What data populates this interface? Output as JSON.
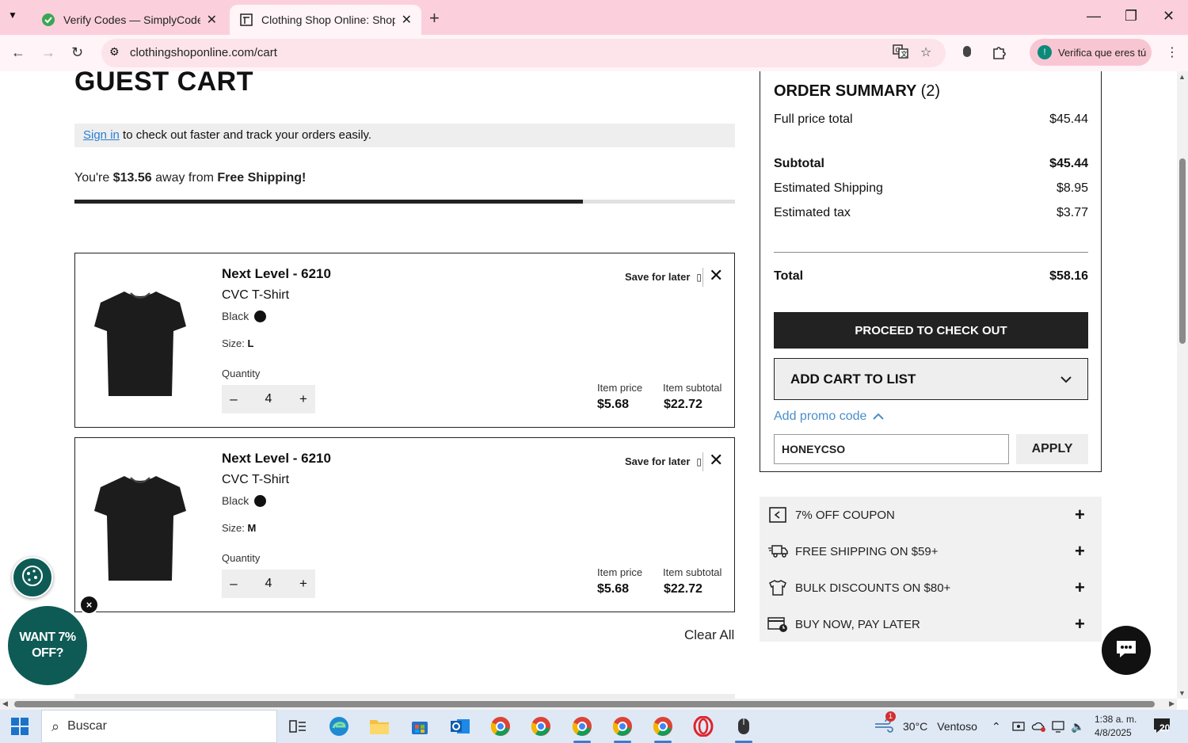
{
  "browser": {
    "tabs": [
      {
        "title": "Verify Codes — SimplyCodes",
        "active": false
      },
      {
        "title": "Clothing Shop Online: Shopping",
        "active": true
      }
    ],
    "url": "clothingshoponline.com/cart",
    "profile_label": "Verifica que eres tú",
    "profile_initial": "!"
  },
  "cart": {
    "title": "GUEST CART",
    "signin_link": "Sign in",
    "signin_text": " to check out faster and track your orders easily.",
    "shipping_prefix": "You're ",
    "shipping_amount": "$13.56",
    "shipping_middle": " away from ",
    "shipping_goal": "Free Shipping!",
    "shipping_progress": 0.77,
    "items": [
      {
        "brand": "Next Level - 6210",
        "name": "CVC T-Shirt",
        "color": "Black",
        "size_label": "Size: ",
        "size": "L",
        "quantity_label": "Quantity",
        "quantity": "4",
        "save_label": "Save for later",
        "price_label": "Item price",
        "price": "$5.68",
        "subtotal_label": "Item subtotal",
        "subtotal": "$22.72"
      },
      {
        "brand": "Next Level - 6210",
        "name": "CVC T-Shirt",
        "color": "Black",
        "size_label": "Size: ",
        "size": "M",
        "quantity_label": "Quantity",
        "quantity": "4",
        "save_label": "Save for later",
        "price_label": "Item price",
        "price": "$5.68",
        "subtotal_label": "Item subtotal",
        "subtotal": "$22.72"
      }
    ],
    "clear_all": "Clear All"
  },
  "summary": {
    "title": "ORDER SUMMARY",
    "count": "(2)",
    "full_price_label": "Full price total",
    "full_price": "$45.44",
    "subtotal_label": "Subtotal",
    "subtotal": "$45.44",
    "shipping_label": "Estimated Shipping",
    "shipping": "$8.95",
    "tax_label": "Estimated tax",
    "tax": "$3.77",
    "total_label": "Total",
    "total": "$58.16",
    "checkout_label": "PROCEED TO CHECK OUT",
    "add_list_label": "ADD CART TO LIST",
    "promo_toggle": "Add promo code",
    "promo_value": "HONEYCSO",
    "apply_label": "APPLY"
  },
  "perks": [
    {
      "label": "7% OFF COUPON",
      "icon": "coupon-icon"
    },
    {
      "label": "FREE SHIPPING ON $59+",
      "icon": "truck-icon"
    },
    {
      "label": "BULK DISCOUNTS ON $80+",
      "icon": "shirt-icon"
    },
    {
      "label": "BUY NOW, PAY LATER",
      "icon": "card-clock-icon"
    }
  ],
  "popup": {
    "close": "×",
    "text": "WANT 7% OFF?"
  },
  "taskbar": {
    "search_placeholder": "Buscar",
    "weather_temp": "30°C",
    "weather_desc": "Ventoso",
    "weather_badge": "1",
    "time": "1:38 a. m.",
    "date": "4/8/2025",
    "notifications": "20"
  },
  "colors": {
    "accent_teal": "#0e5b55",
    "link_blue": "#2a7fd4",
    "tab_bar_pink": "#fbd0dc"
  }
}
